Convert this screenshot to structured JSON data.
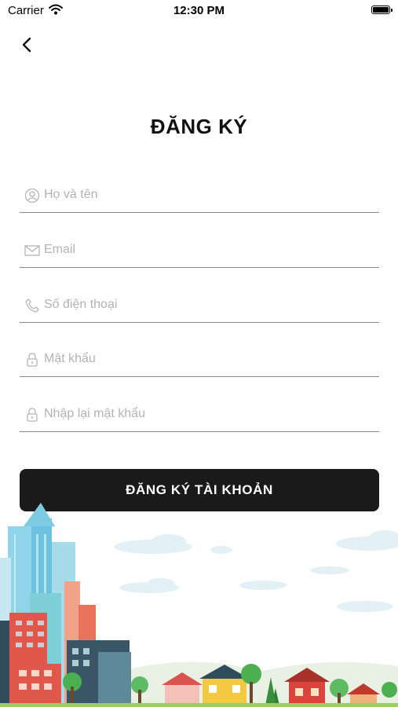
{
  "status_bar": {
    "carrier": "Carrier",
    "time": "12:30 PM"
  },
  "icons": {
    "back": "chevron-left-icon",
    "name": "user-icon",
    "email": "envelope-icon",
    "phone": "phone-icon",
    "password": "lock-icon",
    "confirm_password": "lock-icon"
  },
  "title": "ĐĂNG KÝ",
  "form": {
    "full_name_placeholder": "Họ và tên",
    "email_placeholder": "Email",
    "phone_placeholder": "Số điện thoại",
    "password_placeholder": "Mật khẩu",
    "confirm_password_placeholder": "Nhập lại mật khẩu"
  },
  "submit_label": "ĐĂNG KÝ TÀI KHOẢN",
  "colors": {
    "button": "#1a1a1a",
    "underline": "#8a8a8a",
    "placeholder": "#b3b3b3"
  }
}
